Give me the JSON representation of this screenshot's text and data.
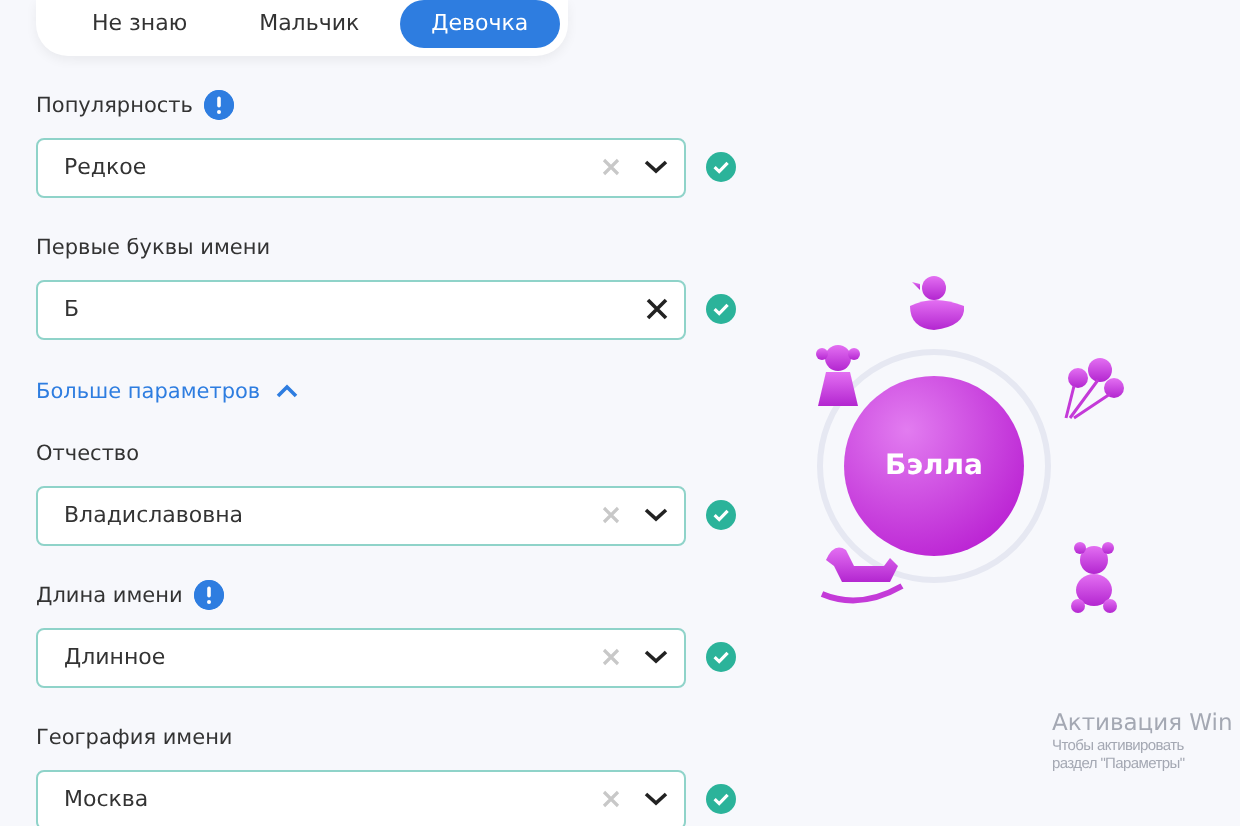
{
  "gender_tabs": [
    {
      "label": "Не знаю",
      "selected": false
    },
    {
      "label": "Мальчик",
      "selected": false
    },
    {
      "label": "Девочка",
      "selected": true
    }
  ],
  "fields_top": [
    {
      "label": "Популярность",
      "info": true,
      "kind": "select",
      "value": "Редкое",
      "valid": true
    },
    {
      "label": "Первые буквы имени",
      "info": false,
      "kind": "text",
      "value": "Б",
      "valid": true
    }
  ],
  "more_parameters": {
    "label": "Больше параметров",
    "expanded": true
  },
  "fields_more": [
    {
      "label": "Отчество",
      "info": false,
      "kind": "select",
      "value": "Владиславовна",
      "valid": true
    },
    {
      "label": "Длина имени",
      "info": true,
      "kind": "select",
      "value": "Длинное",
      "valid": true
    },
    {
      "label": "География имени",
      "info": false,
      "kind": "select",
      "value": "Москва",
      "valid": true
    }
  ],
  "name_card": {
    "name": "Бэлла"
  },
  "activation_notice": {
    "title": "Активация Win",
    "lines": [
      "Чтобы активировать",
      "раздел \"Параметры\""
    ]
  }
}
